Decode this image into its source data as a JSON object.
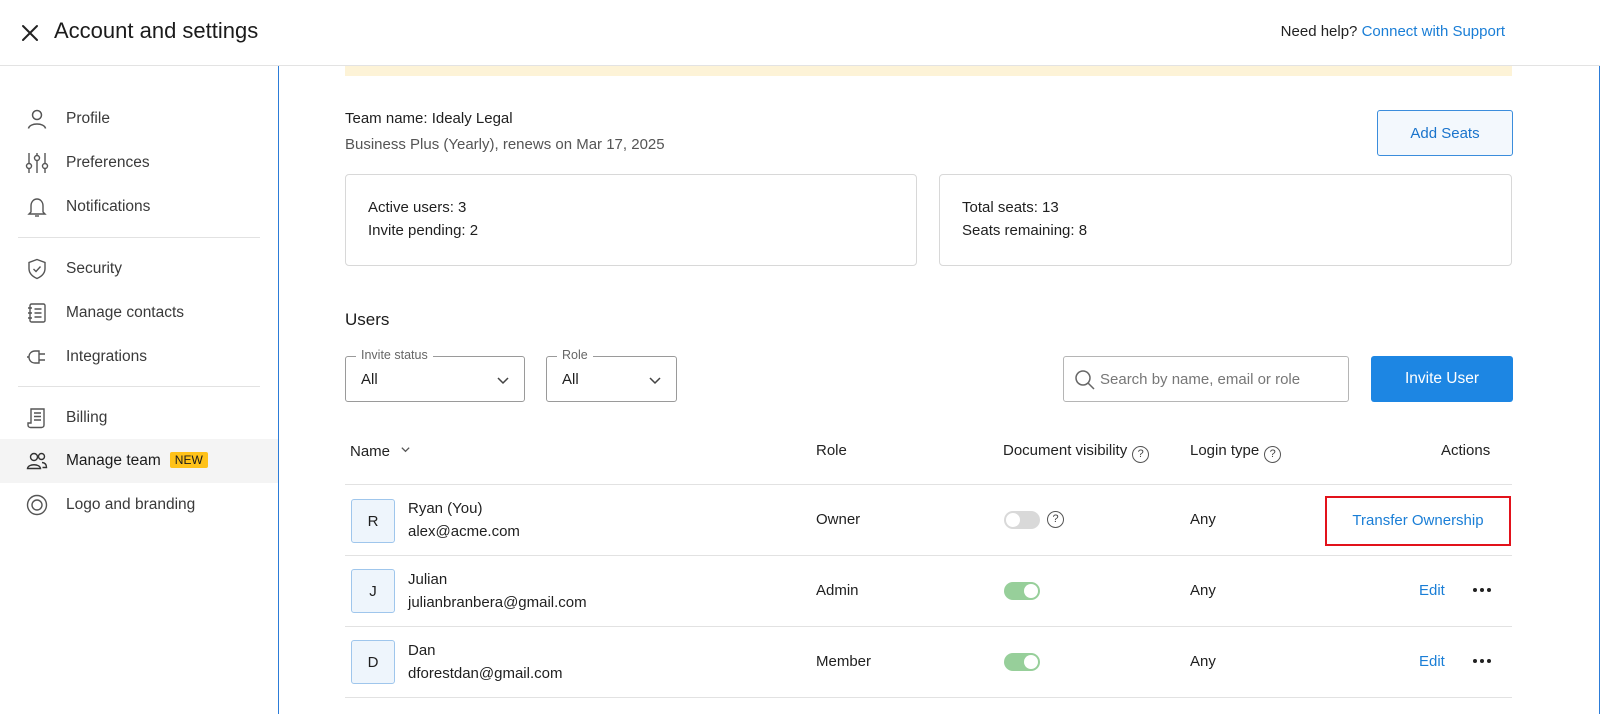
{
  "header": {
    "title": "Account and settings",
    "help_text": "Need help?",
    "help_link": "Connect with Support"
  },
  "sidebar": {
    "items": [
      {
        "label": "Profile",
        "icon": "person-icon"
      },
      {
        "label": "Preferences",
        "icon": "sliders-icon"
      },
      {
        "label": "Notifications",
        "icon": "bell-icon"
      },
      {
        "label": "Security",
        "icon": "shield-icon"
      },
      {
        "label": "Manage contacts",
        "icon": "contacts-icon"
      },
      {
        "label": "Integrations",
        "icon": "plug-icon"
      },
      {
        "label": "Billing",
        "icon": "receipt-icon"
      },
      {
        "label": "Manage team",
        "icon": "team-icon",
        "badge": "NEW",
        "active": true
      },
      {
        "label": "Logo and branding",
        "icon": "branding-icon"
      }
    ]
  },
  "team": {
    "name": "Team name: Idealy Legal",
    "plan": "Business Plus (Yearly), renews on Mar 17, 2025",
    "add_seats_label": "Add Seats"
  },
  "stats": {
    "active_users": "Active users: 3",
    "invite_pending": "Invite pending: 2",
    "total_seats": "Total seats: 13",
    "seats_remaining": "Seats remaining: 8"
  },
  "users_section": {
    "title": "Users",
    "invite_status_label": "Invite status",
    "invite_status_value": "All",
    "role_label": "Role",
    "role_value": "All",
    "search_placeholder": "Search by name, email or role",
    "invite_button": "Invite User"
  },
  "table": {
    "headers": {
      "name": "Name",
      "role": "Role",
      "visibility": "Document visibility",
      "login": "Login type",
      "actions": "Actions"
    },
    "rows": [
      {
        "initial": "R",
        "name": "Ryan (You)",
        "email": "alex@acme.com",
        "role": "Owner",
        "visibility_on": false,
        "login": "Any",
        "action": "Transfer Ownership"
      },
      {
        "initial": "J",
        "name": "Julian",
        "email": "julianbranbera@gmail.com",
        "role": "Admin",
        "visibility_on": true,
        "login": "Any",
        "action": "Edit"
      },
      {
        "initial": "D",
        "name": "Dan",
        "email": "dforestdan@gmail.com",
        "role": "Member",
        "visibility_on": true,
        "login": "Any",
        "action": "Edit"
      }
    ]
  },
  "colors": {
    "accent": "#1d86e3",
    "link": "#1a7ed6",
    "toggle_on": "#97cf9a",
    "badge": "#ffc21a",
    "highlight": "#e2121b"
  }
}
